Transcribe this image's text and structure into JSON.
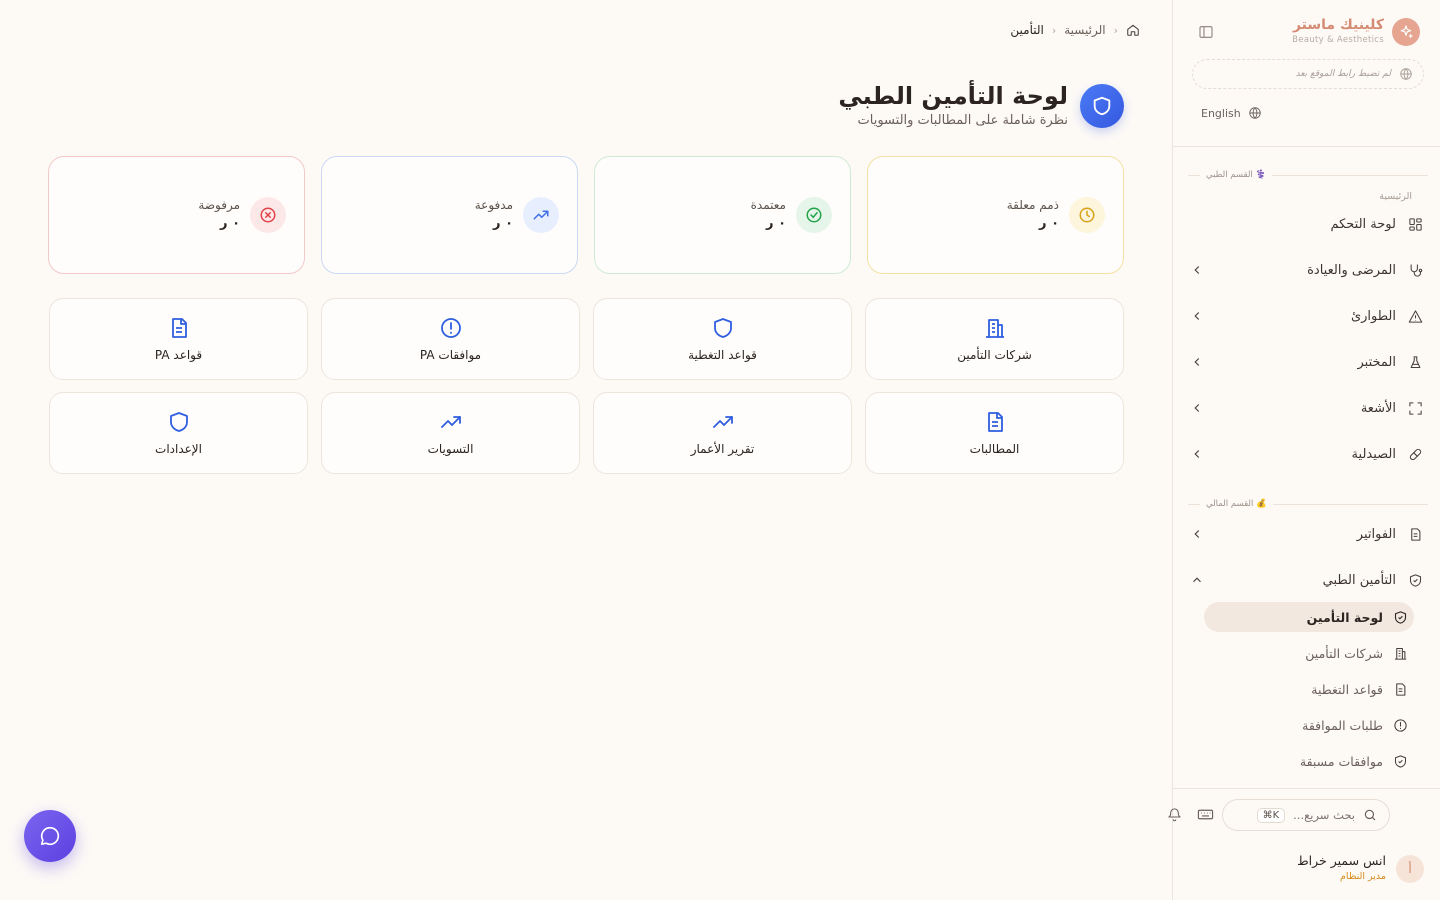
{
  "brand": {
    "name": "كلينيك ماستر",
    "tagline": "Beauty & Aesthetics"
  },
  "sidebar": {
    "site_link_placeholder": "لم تضبط رابط الموقع بعد",
    "language": "English",
    "section_medical": "⚕️ القسم الطبي",
    "home_label": "الرئيسية",
    "items": [
      {
        "label": "لوحة التحكم",
        "icon": "dashboard-grid-icon"
      },
      {
        "label": "المرضى والعيادة",
        "icon": "stethoscope-icon"
      },
      {
        "label": "الطوارئ",
        "icon": "warning-triangle-icon"
      },
      {
        "label": "المختبر",
        "icon": "flask-icon"
      },
      {
        "label": "الأشعة",
        "icon": "scan-frame-icon"
      },
      {
        "label": "الصيدلية",
        "icon": "pill-icon"
      }
    ],
    "section_finance": "💰 القسم المالي",
    "finance_items": [
      {
        "label": "الفواتير",
        "icon": "invoice-icon"
      },
      {
        "label": "التأمين الطبي",
        "icon": "shield-check-icon"
      }
    ],
    "insurance_sub": [
      {
        "label": "لوحة التأمين",
        "icon": "shield-check-icon",
        "active": true
      },
      {
        "label": "شركات التأمين",
        "icon": "building-icon"
      },
      {
        "label": "قواعد التغطية",
        "icon": "document-icon"
      },
      {
        "label": "طلبات الموافقة",
        "icon": "alert-circle-icon"
      },
      {
        "label": "موافقات مسبقة",
        "icon": "shield-check-icon"
      }
    ],
    "search_placeholder": "بحث سريع...",
    "search_shortcut": "⌘K"
  },
  "user": {
    "initial": "أ",
    "name": "انس سمير خراط",
    "role": "مدير النظام"
  },
  "breadcrumb": {
    "home": "الرئيسية",
    "current": "التأمين"
  },
  "page": {
    "title": "لوحة التأمين الطبي",
    "subtitle": "نظرة شاملة على المطالبات والتسويات"
  },
  "stats": [
    {
      "label": "ذمم معلقة",
      "value": "٠ ر",
      "icon": "clock-icon",
      "color": "#d9a21b"
    },
    {
      "label": "معتمدة",
      "value": "٠ ر",
      "icon": "check-circle-icon",
      "color": "#22a34a"
    },
    {
      "label": "مدفوعة",
      "value": "٠ ر",
      "icon": "trending-up-icon",
      "color": "#3f6fe8"
    },
    {
      "label": "مرفوضة",
      "value": "٠ ر",
      "icon": "x-circle-icon",
      "color": "#e0424a"
    }
  ],
  "tiles": [
    {
      "label": "شركات التأمين",
      "icon": "building-icon"
    },
    {
      "label": "قواعد التغطية",
      "icon": "shield-icon"
    },
    {
      "label": "موافقات PA",
      "icon": "alert-circle-icon"
    },
    {
      "label": "قواعد PA",
      "icon": "document-icon"
    },
    {
      "label": "المطالبات",
      "icon": "document-icon"
    },
    {
      "label": "تقرير الأعمار",
      "icon": "trending-up-icon"
    },
    {
      "label": "التسويات",
      "icon": "trending-up-icon"
    },
    {
      "label": "الإعدادات",
      "icon": "shield-icon"
    }
  ],
  "colors": {
    "accent_blue": "#2f5fe0",
    "brand": "#d48b73",
    "chat": "#6a50e8"
  }
}
